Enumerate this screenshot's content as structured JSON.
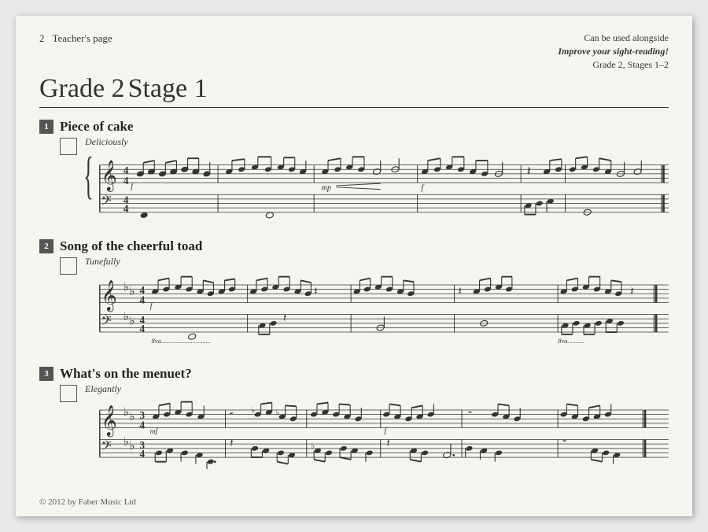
{
  "page": {
    "number": "2",
    "header_label": "Teacher's page",
    "grade_label": "Grade 2",
    "stage_label": "Stage 1",
    "aside_line1": "Can be used alongside",
    "aside_line2": "Improve your sight-reading!",
    "aside_line3": "Grade 2, Stages 1–2"
  },
  "exercises": [
    {
      "number": "1",
      "title": "Piece of cake",
      "tempo": "Deliciously"
    },
    {
      "number": "2",
      "title": "Song of the cheerful toad",
      "tempo": "Tunefully"
    },
    {
      "number": "3",
      "title": "What's on the menuet?",
      "tempo": "Elegantly"
    }
  ],
  "footer": {
    "copyright": "© 2012 by Faber Music Ltd"
  }
}
